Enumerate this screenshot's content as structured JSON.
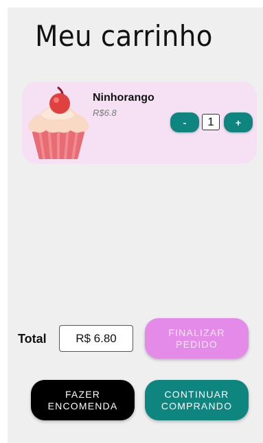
{
  "header": {
    "title": "Meu carrinho"
  },
  "cart": {
    "items": [
      {
        "name": "Ninhorango",
        "price": "R$6.8",
        "quantity": "1",
        "image_icon": "cupcake-icon",
        "decrement_label": "-",
        "increment_label": "+"
      }
    ]
  },
  "summary": {
    "total_label": "Total",
    "total_value": "R$ 6.80"
  },
  "actions": {
    "finalize_label": "FINALIZAR\nPEDIDO",
    "order_label": "FAZER\nENCOMENDA",
    "continue_label": "CONTINUAR\nCOMPRANDO"
  },
  "colors": {
    "background": "#efefef",
    "card": "#f5e1f3",
    "teal": "#0f8580",
    "pink": "#e48be9",
    "black": "#000000"
  }
}
